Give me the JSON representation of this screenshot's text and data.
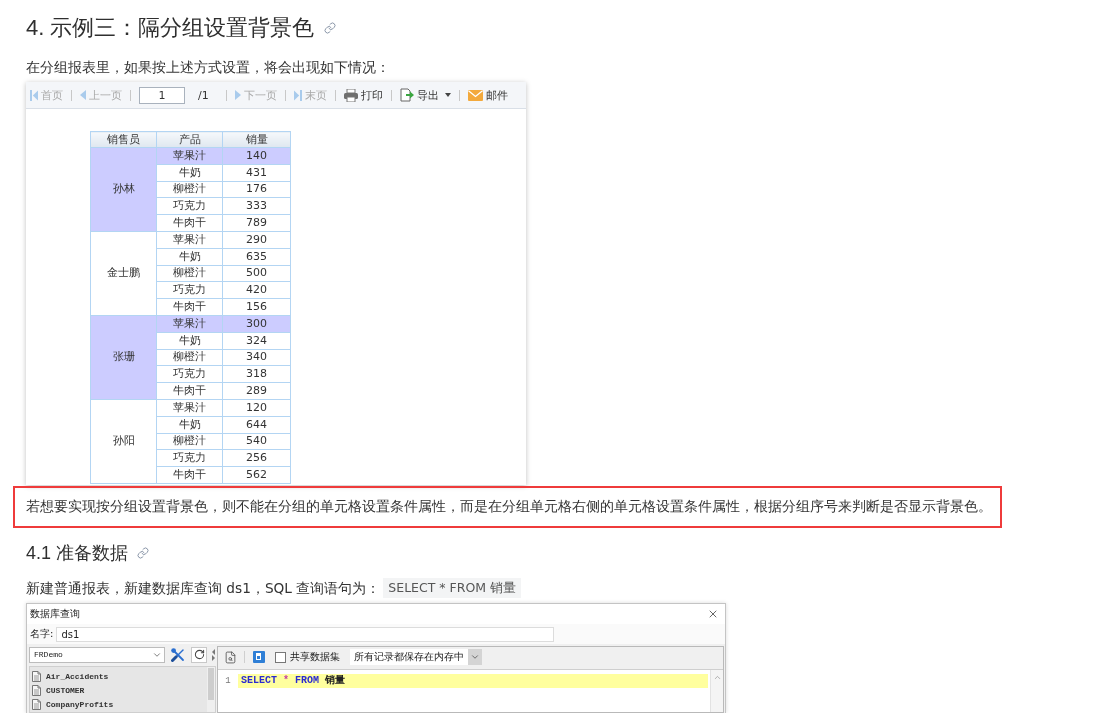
{
  "heading": {
    "text": "4. 示例三：隔分组设置背景色"
  },
  "intro": "在分组报表里，如果按上述方式设置，将会出现如下情况：",
  "report_preview": {
    "toolbar": [
      {
        "kind": "first",
        "label": "首页",
        "disabled": true
      },
      {
        "kind": "previous",
        "label": "上一页",
        "disabled": true
      },
      {
        "kind": "page",
        "value": "1",
        "total": "/1"
      },
      {
        "kind": "next",
        "label": "下一页",
        "disabled": true
      },
      {
        "kind": "last",
        "label": "末页",
        "disabled": true
      },
      {
        "kind": "print",
        "label": "打印",
        "disabled": false
      },
      {
        "kind": "export",
        "label": "导出",
        "disabled": false
      },
      {
        "kind": "mail",
        "label": "邮件",
        "disabled": false
      }
    ],
    "table": {
      "columns": [
        "销售员",
        "产品",
        "销量"
      ],
      "groups": [
        {
          "salesperson": "孙林",
          "highlighted": true,
          "rows": [
            {
              "product": "苹果汁",
              "sales": "140",
              "highlighted": true
            },
            {
              "product": "牛奶",
              "sales": "431",
              "highlighted": false
            },
            {
              "product": "柳橙汁",
              "sales": "176",
              "highlighted": false
            },
            {
              "product": "巧克力",
              "sales": "333",
              "highlighted": false
            },
            {
              "product": "牛肉干",
              "sales": "789",
              "highlighted": false
            }
          ]
        },
        {
          "salesperson": "金士鹏",
          "highlighted": false,
          "rows": [
            {
              "product": "苹果汁",
              "sales": "290",
              "highlighted": false
            },
            {
              "product": "牛奶",
              "sales": "635",
              "highlighted": false
            },
            {
              "product": "柳橙汁",
              "sales": "500",
              "highlighted": false
            },
            {
              "product": "巧克力",
              "sales": "420",
              "highlighted": false
            },
            {
              "product": "牛肉干",
              "sales": "156",
              "highlighted": false
            }
          ]
        },
        {
          "salesperson": "张珊",
          "highlighted": true,
          "rows": [
            {
              "product": "苹果汁",
              "sales": "300",
              "highlighted": true
            },
            {
              "product": "牛奶",
              "sales": "324",
              "highlighted": false
            },
            {
              "product": "柳橙汁",
              "sales": "340",
              "highlighted": false
            },
            {
              "product": "巧克力",
              "sales": "318",
              "highlighted": false
            },
            {
              "product": "牛肉干",
              "sales": "289",
              "highlighted": false
            }
          ]
        },
        {
          "salesperson": "孙阳",
          "highlighted": false,
          "rows": [
            {
              "product": "苹果汁",
              "sales": "120",
              "highlighted": false
            },
            {
              "product": "牛奶",
              "sales": "644",
              "highlighted": false
            },
            {
              "product": "柳橙汁",
              "sales": "540",
              "highlighted": false
            },
            {
              "product": "巧克力",
              "sales": "256",
              "highlighted": false
            },
            {
              "product": "牛肉干",
              "sales": "562",
              "highlighted": false
            }
          ]
        }
      ]
    }
  },
  "callout": "若想要实现按分组设置背景色，则不能在分组的单元格设置条件属性，而是在分组单元格右侧的单元格设置条件属性，根据分组序号来判断是否显示背景色。",
  "subheading": {
    "text": "4.1 准备数据"
  },
  "paragraph": {
    "text": "新建普通报表，新建数据库查询 ds1，SQL 查询语句为：",
    "code": "SELECT * FROM 销量"
  },
  "query_dialog": {
    "title": "数据库查询",
    "name_label": "名字:",
    "name_value": "ds1",
    "connection": "FRDemo",
    "tables": [
      "Air_Accidents",
      "CUSTOMER",
      "CompanyProfits"
    ],
    "share_dataset": {
      "label": "共享数据集",
      "checked": false
    },
    "storage_mode": "所有记录都保存在内存中",
    "sql_lines": [
      {
        "number": "1",
        "tokens": [
          {
            "kind": "keyword",
            "text": "SELECT"
          },
          {
            "kind": "operator",
            "text": "*"
          },
          {
            "kind": "keyword",
            "text": "FROM"
          },
          {
            "kind": "plain",
            "text": "销量"
          }
        ]
      }
    ]
  }
}
